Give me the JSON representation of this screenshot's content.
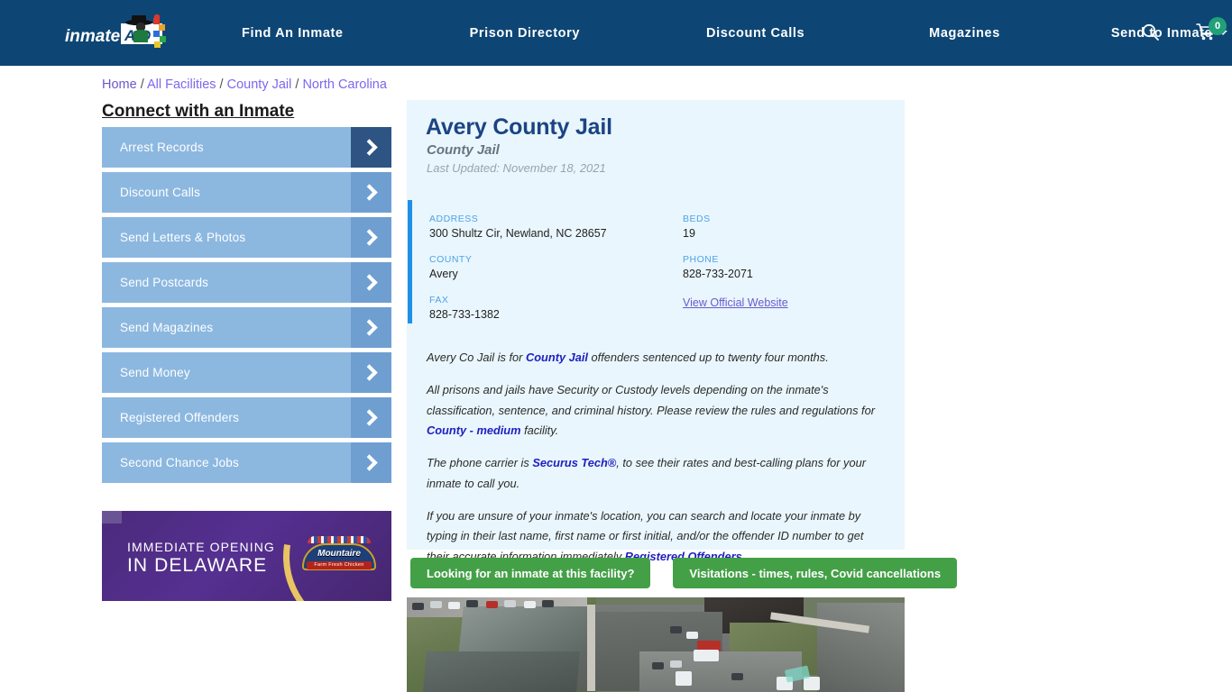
{
  "header": {
    "logo_text_1": "inmate",
    "logo_text_2": "AID",
    "nav": [
      {
        "label": "Find An Inmate"
      },
      {
        "label": "Prison Directory"
      },
      {
        "label": "Discount Calls"
      },
      {
        "label": "Magazines"
      },
      {
        "label": "Send to Inmate"
      }
    ],
    "icons": {
      "search": "search-icon",
      "cart": "cart-icon",
      "user": "user-icon"
    },
    "cart_count": "0",
    "colors": {
      "header_bg": "#0d4675",
      "cart_badge": "#21a179"
    }
  },
  "breadcrumb": {
    "items": [
      "Home",
      "All Facilities",
      "County Jail",
      "North Carolina"
    ],
    "separator": "/"
  },
  "sidebar": {
    "title": "Connect with an Inmate",
    "items": [
      {
        "label": "Arrest Records"
      },
      {
        "label": "Discount Calls"
      },
      {
        "label": "Send Letters & Photos"
      },
      {
        "label": "Send Postcards"
      },
      {
        "label": "Send Magazines"
      },
      {
        "label": "Send Money"
      },
      {
        "label": "Registered Offenders"
      },
      {
        "label": "Second Chance Jobs"
      }
    ],
    "active_index": 0
  },
  "ad": {
    "line1": "IMMEDIATE OPENING",
    "line2": "IN DELAWARE",
    "brand": "Mountaire",
    "brand_sub": "Farm Fresh Chicken"
  },
  "facility": {
    "name": "Avery County Jail",
    "type": "County Jail",
    "last_updated": "Last Updated: November 18, 2021",
    "details": {
      "address_label": "ADDRESS",
      "address_value": "300 Shultz Cir, Newland, NC 28657",
      "county_label": "COUNTY",
      "county_value": "Avery",
      "fax_label": "FAX",
      "fax_value": "828-733-1382",
      "beds_label": "BEDS",
      "beds_value": "19",
      "phone_label": "PHONE",
      "phone_value": "828-733-2071",
      "website_link": "View Official Website"
    }
  },
  "body": {
    "p1_a": "Avery Co Jail is for ",
    "p1_link": "County Jail",
    "p1_b": " offenders sentenced up to twenty four months.",
    "p2_a": "All prisons and jails have Security or Custody levels depending on the inmate's classification, sentence, and criminal history. Please review the rules and regulations for ",
    "p2_link": "County - medium",
    "p2_b": " facility.",
    "p3_a": "The phone carrier is ",
    "p3_link": "Securus Tech®",
    "p3_b": ", to see their rates and best-calling plans for your inmate to call you.",
    "p4_a": "If you are unsure of your inmate's location, you can search and locate your inmate by typing in their last name, first name or first initial, and/or the offender ID number to get their accurate information immediately ",
    "p4_link": "Registered Offenders"
  },
  "cta": {
    "primary": "Looking for an inmate at this facility?",
    "secondary": "Visitations - times, rules, Covid cancellations",
    "color": "#43a047"
  },
  "aerial": {
    "caption": "Aerial satellite view of Avery County Jail facility"
  }
}
